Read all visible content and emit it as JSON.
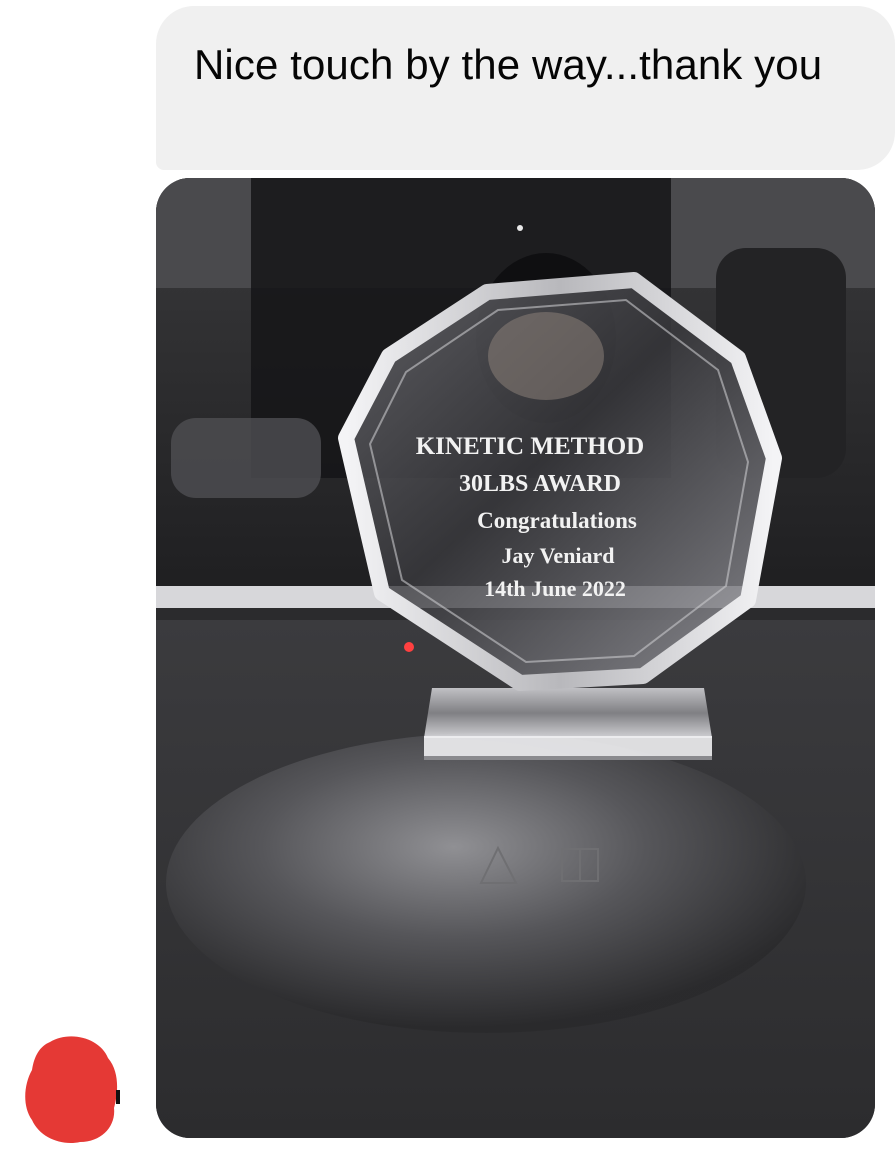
{
  "message": {
    "text": "Nice touch by the way...thank you"
  },
  "photo": {
    "trophy_lines": [
      "KINETIC METHOD",
      "30LBS AWARD",
      "Congratulations",
      "Jay Veniard",
      "14th June 2022"
    ]
  },
  "colors": {
    "bubble_bg": "#f0f0f0",
    "text": "#050505",
    "avatar_redaction": "#e53935"
  },
  "icons": {
    "avatar": "redacted-avatar-icon",
    "logo": "laptop-brand-logo-icon"
  }
}
